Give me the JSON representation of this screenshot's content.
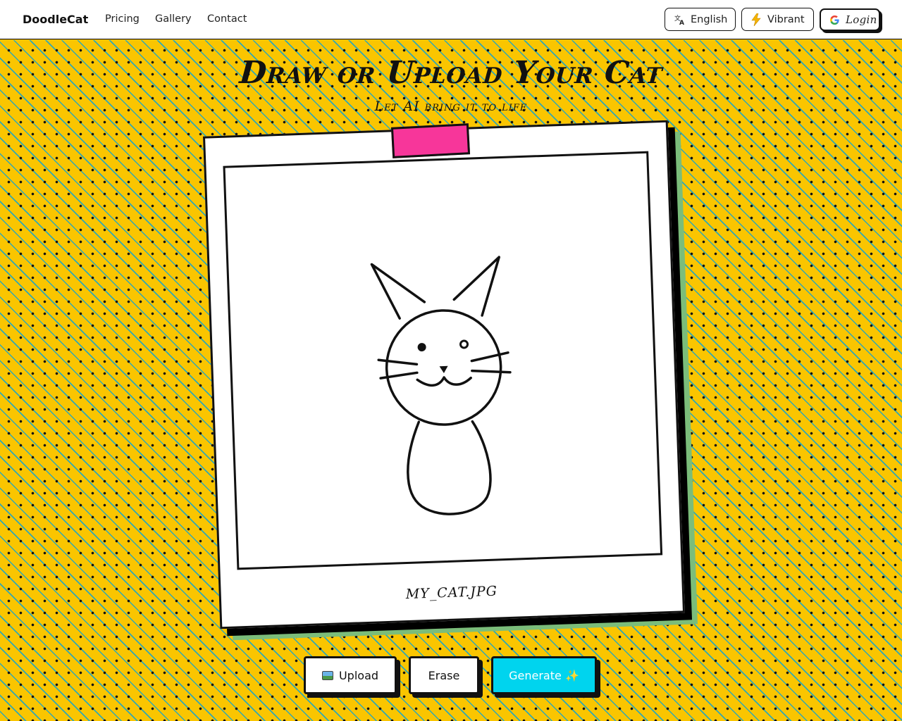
{
  "nav": {
    "brand": "DoodleCat",
    "links": [
      "Pricing",
      "Gallery",
      "Contact"
    ],
    "language_label": "English",
    "language_icon": "translate-icon",
    "theme_label": "Vibrant",
    "theme_icon": "lightning-icon",
    "login_label": "Login",
    "login_icon": "google-icon"
  },
  "hero": {
    "title": "Draw or Upload Your Cat",
    "subtitle": "Let AI bring it to life"
  },
  "canvas": {
    "caption": "MY_CAT.JPG",
    "drawing": "cat-doodle"
  },
  "actions": {
    "upload_label": "Upload",
    "upload_icon": "image-icon",
    "erase_label": "Erase",
    "generate_label": "Generate ✨"
  },
  "colors": {
    "background": "#fac500",
    "tape": "#f7369a",
    "generate_button": "#00d4ee",
    "stripe": "#2fa8b6",
    "polaroid_shadow": "#7bbd7a"
  }
}
